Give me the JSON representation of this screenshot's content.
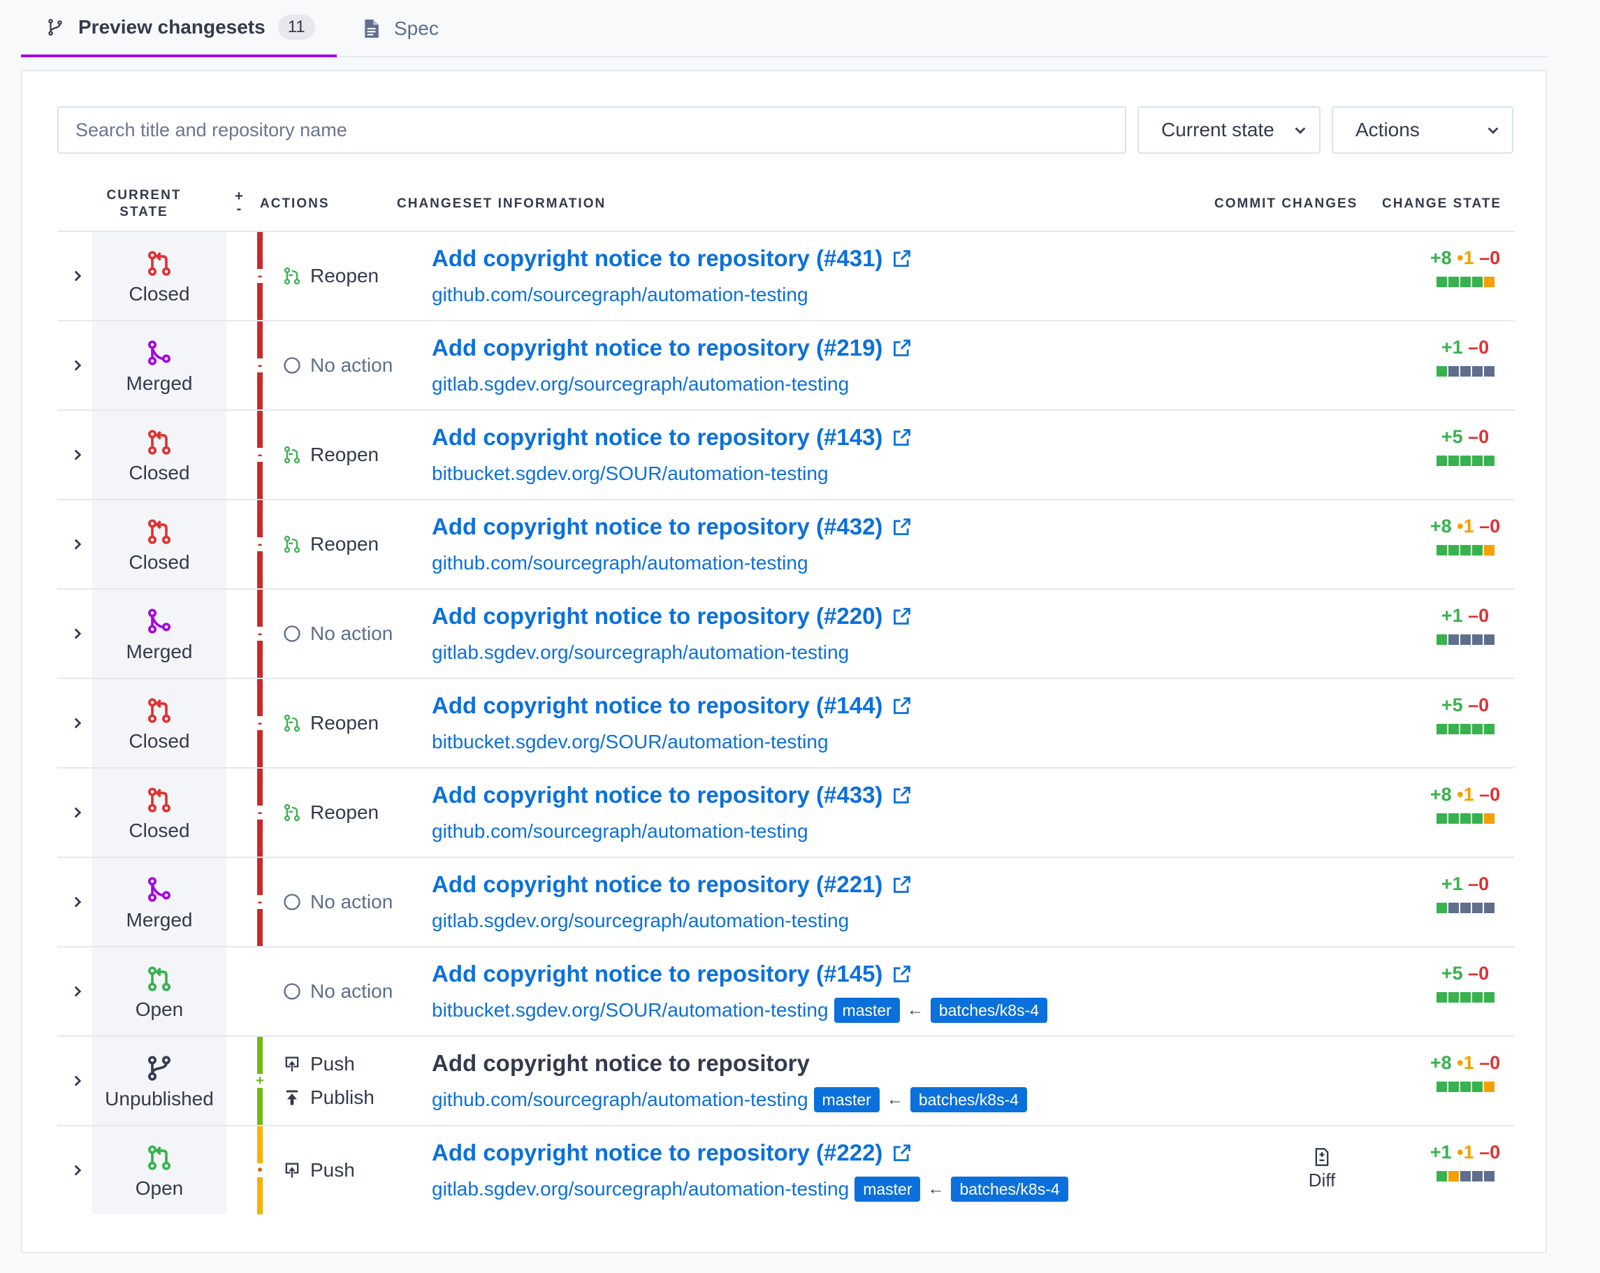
{
  "tabs": {
    "preview_label": "Preview changesets",
    "preview_count": "11",
    "spec_label": "Spec"
  },
  "filters": {
    "search_placeholder": "Search title and repository name",
    "state_select": "Current state",
    "actions_select": "Actions"
  },
  "table": {
    "headers": {
      "current_state_1": "CURRENT",
      "current_state_2": "STATE",
      "plus": "+",
      "minus": "-",
      "actions": "ACTIONS",
      "info": "CHANGESET INFORMATION",
      "commit": "COMMIT CHANGES",
      "change_state": "CHANGE STATE"
    },
    "rows": [
      {
        "state": "Closed",
        "state_icon": "pull-request-closed-icon",
        "bar": "red",
        "bar_mark": "-",
        "actions": [
          {
            "label": "Reopen",
            "icon": "reopen-icon"
          }
        ],
        "title": "Add copyright notice to repository (#431)",
        "title_link": true,
        "repo": "github.com/sourcegraph/automation-testing",
        "branches": null,
        "commit": null,
        "diff": {
          "add": "+8",
          "chg": "•1",
          "del": "–0"
        },
        "squares": [
          "g",
          "g",
          "g",
          "g",
          "o"
        ]
      },
      {
        "state": "Merged",
        "state_icon": "merged-icon",
        "bar": "red",
        "bar_mark": "-",
        "actions": [
          {
            "label": "No action",
            "icon": "circle-icon"
          }
        ],
        "title": "Add copyright notice to repository (#219)",
        "title_link": true,
        "repo": "gitlab.sgdev.org/sourcegraph/automation-testing",
        "branches": null,
        "commit": null,
        "diff": {
          "add": "+1",
          "chg": "",
          "del": "–0"
        },
        "squares": [
          "g",
          "n",
          "n",
          "n",
          "n"
        ]
      },
      {
        "state": "Closed",
        "state_icon": "pull-request-closed-icon",
        "bar": "red",
        "bar_mark": "-",
        "actions": [
          {
            "label": "Reopen",
            "icon": "reopen-icon"
          }
        ],
        "title": "Add copyright notice to repository (#143)",
        "title_link": true,
        "repo": "bitbucket.sgdev.org/SOUR/automation-testing",
        "branches": null,
        "commit": null,
        "diff": {
          "add": "+5",
          "chg": "",
          "del": "–0"
        },
        "squares": [
          "g",
          "g",
          "g",
          "g",
          "g"
        ]
      },
      {
        "state": "Closed",
        "state_icon": "pull-request-closed-icon",
        "bar": "red",
        "bar_mark": "-",
        "actions": [
          {
            "label": "Reopen",
            "icon": "reopen-icon"
          }
        ],
        "title": "Add copyright notice to repository (#432)",
        "title_link": true,
        "repo": "github.com/sourcegraph/automation-testing",
        "branches": null,
        "commit": null,
        "diff": {
          "add": "+8",
          "chg": "•1",
          "del": "–0"
        },
        "squares": [
          "g",
          "g",
          "g",
          "g",
          "o"
        ]
      },
      {
        "state": "Merged",
        "state_icon": "merged-icon",
        "bar": "red",
        "bar_mark": "-",
        "actions": [
          {
            "label": "No action",
            "icon": "circle-icon"
          }
        ],
        "title": "Add copyright notice to repository (#220)",
        "title_link": true,
        "repo": "gitlab.sgdev.org/sourcegraph/automation-testing",
        "branches": null,
        "commit": null,
        "diff": {
          "add": "+1",
          "chg": "",
          "del": "–0"
        },
        "squares": [
          "g",
          "n",
          "n",
          "n",
          "n"
        ]
      },
      {
        "state": "Closed",
        "state_icon": "pull-request-closed-icon",
        "bar": "red",
        "bar_mark": "-",
        "actions": [
          {
            "label": "Reopen",
            "icon": "reopen-icon"
          }
        ],
        "title": "Add copyright notice to repository (#144)",
        "title_link": true,
        "repo": "bitbucket.sgdev.org/SOUR/automation-testing",
        "branches": null,
        "commit": null,
        "diff": {
          "add": "+5",
          "chg": "",
          "del": "–0"
        },
        "squares": [
          "g",
          "g",
          "g",
          "g",
          "g"
        ]
      },
      {
        "state": "Closed",
        "state_icon": "pull-request-closed-icon",
        "bar": "red",
        "bar_mark": "-",
        "actions": [
          {
            "label": "Reopen",
            "icon": "reopen-icon"
          }
        ],
        "title": "Add copyright notice to repository (#433)",
        "title_link": true,
        "repo": "github.com/sourcegraph/automation-testing",
        "branches": null,
        "commit": null,
        "diff": {
          "add": "+8",
          "chg": "•1",
          "del": "–0"
        },
        "squares": [
          "g",
          "g",
          "g",
          "g",
          "o"
        ]
      },
      {
        "state": "Merged",
        "state_icon": "merged-icon",
        "bar": "red",
        "bar_mark": "-",
        "actions": [
          {
            "label": "No action",
            "icon": "circle-icon"
          }
        ],
        "title": "Add copyright notice to repository (#221)",
        "title_link": true,
        "repo": "gitlab.sgdev.org/sourcegraph/automation-testing",
        "branches": null,
        "commit": null,
        "diff": {
          "add": "+1",
          "chg": "",
          "del": "–0"
        },
        "squares": [
          "g",
          "n",
          "n",
          "n",
          "n"
        ]
      },
      {
        "state": "Open",
        "state_icon": "pull-request-open-icon",
        "bar": "none",
        "bar_mark": "",
        "actions": [
          {
            "label": "No action",
            "icon": "circle-icon"
          }
        ],
        "title": "Add copyright notice to repository (#145)",
        "title_link": true,
        "repo": "bitbucket.sgdev.org/SOUR/automation-testing",
        "branches": {
          "base": "master",
          "head": "batches/k8s-4"
        },
        "commit": null,
        "diff": {
          "add": "+5",
          "chg": "",
          "del": "–0"
        },
        "squares": [
          "g",
          "g",
          "g",
          "g",
          "g"
        ]
      },
      {
        "state": "Unpublished",
        "state_icon": "branch-icon",
        "bar": "green",
        "bar_mark": "+",
        "actions": [
          {
            "label": "Push",
            "icon": "push-icon"
          },
          {
            "label": "Publish",
            "icon": "publish-icon"
          }
        ],
        "title": "Add copyright notice to repository",
        "title_link": false,
        "repo": "github.com/sourcegraph/automation-testing",
        "branches": {
          "base": "master",
          "head": "batches/k8s-4"
        },
        "commit": null,
        "diff": {
          "add": "+8",
          "chg": "•1",
          "del": "–0"
        },
        "squares": [
          "g",
          "g",
          "g",
          "g",
          "o"
        ]
      },
      {
        "state": "Open",
        "state_icon": "pull-request-open-icon",
        "bar": "yellow",
        "bar_mark": "•",
        "actions": [
          {
            "label": "Push",
            "icon": "push-icon"
          }
        ],
        "title": "Add copyright notice to repository (#222)",
        "title_link": true,
        "repo": "gitlab.sgdev.org/sourcegraph/automation-testing",
        "branches": {
          "base": "master",
          "head": "batches/k8s-4"
        },
        "commit": "Diff",
        "diff": {
          "add": "+1",
          "chg": "•1",
          "del": "–0"
        },
        "squares": [
          "g",
          "o",
          "n",
          "n",
          "n"
        ]
      }
    ],
    "branch_arrow": "←"
  },
  "colors": {
    "accent": "#a305e1",
    "link": "#0b70db",
    "closed": "#e03131",
    "merged": "#a305e1",
    "open": "#37b24d",
    "bar_red": "#c92a2a",
    "bar_green": "#74b816",
    "bar_yellow": "#fab005"
  }
}
